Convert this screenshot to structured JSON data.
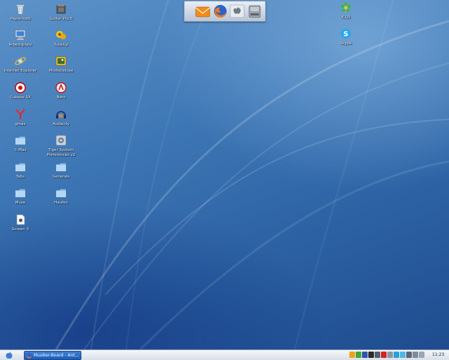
{
  "desktop": {
    "left_column": [
      {
        "label": "Papierkorb",
        "icon": "trash-icon"
      },
      {
        "label": "Arbeitsplatz",
        "icon": "computer-icon"
      },
      {
        "label": "Internet Explorer",
        "icon": "internet-explorer-icon"
      },
      {
        "label": "Cubase SX",
        "icon": "cubase-icon"
      },
      {
        "label": "gmax",
        "icon": "gmax-icon"
      },
      {
        "label": "C-Max",
        "icon": "folder-icon"
      },
      {
        "label": "Tabs",
        "icon": "folder-icon"
      },
      {
        "label": "Muze",
        "icon": "folder-icon"
      },
      {
        "label": "Screen 3",
        "icon": "image-file-icon"
      }
    ],
    "second_column": [
      {
        "label": "Guitar Pro 5",
        "icon": "guitar-pro-icon"
      },
      {
        "label": "TuneUp",
        "icon": "tuneup-icon"
      },
      {
        "label": "PhotoDeluxe",
        "icon": "photodeluxe-icon"
      },
      {
        "label": "Nero",
        "icon": "nero-icon"
      },
      {
        "label": "Audacity",
        "icon": "audacity-icon"
      },
      {
        "label": "Tiger System Preferences v2",
        "icon": "system-preferences-icon"
      },
      {
        "label": "Generals",
        "icon": "folder-icon"
      },
      {
        "label": "Haufen",
        "icon": "folder-icon"
      }
    ],
    "right_column": [
      {
        "label": "ICQ5",
        "icon": "icq-icon"
      },
      {
        "label": "Skype",
        "icon": "skype-icon"
      }
    ]
  },
  "dock": {
    "items": [
      "mail-icon",
      "firefox-icon",
      "finder-icon",
      "hard-drive-icon"
    ]
  },
  "taskbar": {
    "start_icon": "apple-icon",
    "window_button_label": "Musiker-Board - Ant...",
    "clock": "11:23"
  },
  "colors": {
    "desktop_blue": "#2d63a5",
    "folder": "#8fbde8",
    "taskbar": "#e6ebf2",
    "active_task": "#2a6cc6"
  }
}
